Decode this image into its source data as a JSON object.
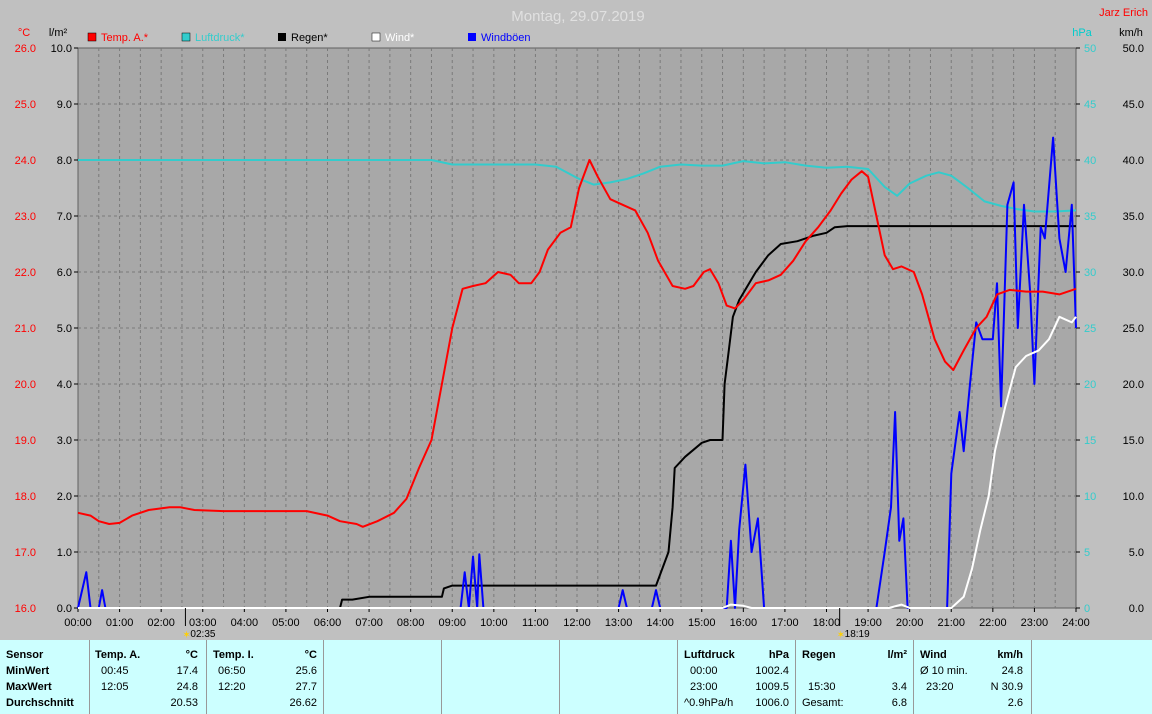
{
  "header": {
    "title": "Montag, 29.07.2019",
    "author": "Jarz Erich"
  },
  "colors": {
    "temp": "#ff0000",
    "pressure": "#33cccc",
    "rain": "#000000",
    "wind": "#ffffff",
    "gust": "#0000ff",
    "plot_bg": "#a8a8a8",
    "grid": "#808080"
  },
  "chart_data": {
    "type": "line",
    "title": "Montag, 29.07.2019",
    "legend": [
      "Temp. A.*",
      "Luftdruck*",
      "Regen*",
      "Wind*",
      "Windböen"
    ],
    "x_ticks": [
      "00:00",
      "01:00",
      "02:00",
      "03:00",
      "04:00",
      "05:00",
      "06:00",
      "07:00",
      "08:00",
      "09:00",
      "10:00",
      "11:00",
      "12:00",
      "13:00",
      "14:00",
      "15:00",
      "16:00",
      "17:00",
      "18:00",
      "19:00",
      "20:00",
      "21:00",
      "22:00",
      "23:00",
      "24:00"
    ],
    "axes": {
      "temp": {
        "unit": "°C",
        "range": [
          16,
          26
        ],
        "ticks": [
          "16.0",
          "17.0",
          "18.0",
          "19.0",
          "20.0",
          "21.0",
          "22.0",
          "23.0",
          "24.0",
          "25.0",
          "26.0"
        ]
      },
      "rain": {
        "unit": "l/m²",
        "range": [
          0,
          10
        ],
        "ticks": [
          "0.0",
          "1.0",
          "2.0",
          "3.0",
          "4.0",
          "5.0",
          "6.0",
          "7.0",
          "8.0",
          "9.0",
          "10.0"
        ]
      },
      "pressure": {
        "unit": "hPa",
        "ticks": [
          "0",
          "5",
          "10",
          "15",
          "20",
          "25",
          "30",
          "35",
          "40",
          "45",
          "50"
        ]
      },
      "wind": {
        "unit": "km/h",
        "range": [
          0,
          50
        ],
        "ticks": [
          "0.0",
          "5.0",
          "10.0",
          "15.0",
          "20.0",
          "25.0",
          "30.0",
          "35.0",
          "40.0",
          "45.0",
          "50.0"
        ]
      }
    },
    "markers": [
      {
        "time": "02:35"
      },
      {
        "time": "18:19"
      }
    ],
    "series": [
      {
        "name": "Temp. A.*",
        "axis": "temp",
        "points": [
          [
            0,
            17.7
          ],
          [
            0.3,
            17.65
          ],
          [
            0.5,
            17.55
          ],
          [
            0.75,
            17.5
          ],
          [
            1.0,
            17.52
          ],
          [
            1.3,
            17.65
          ],
          [
            1.7,
            17.75
          ],
          [
            2.2,
            17.8
          ],
          [
            2.45,
            17.8
          ],
          [
            2.8,
            17.75
          ],
          [
            3.5,
            17.73
          ],
          [
            4.5,
            17.73
          ],
          [
            5.5,
            17.73
          ],
          [
            6.0,
            17.65
          ],
          [
            6.3,
            17.55
          ],
          [
            6.7,
            17.5
          ],
          [
            6.85,
            17.45
          ],
          [
            7.2,
            17.55
          ],
          [
            7.6,
            17.7
          ],
          [
            7.9,
            17.95
          ],
          [
            8.2,
            18.5
          ],
          [
            8.5,
            19.0
          ],
          [
            8.75,
            20.0
          ],
          [
            9.0,
            21.0
          ],
          [
            9.25,
            21.7
          ],
          [
            9.5,
            21.75
          ],
          [
            9.8,
            21.8
          ],
          [
            10.1,
            22.0
          ],
          [
            10.4,
            21.95
          ],
          [
            10.6,
            21.8
          ],
          [
            10.9,
            21.8
          ],
          [
            11.1,
            22.0
          ],
          [
            11.3,
            22.4
          ],
          [
            11.6,
            22.7
          ],
          [
            11.85,
            22.8
          ],
          [
            12.05,
            23.5
          ],
          [
            12.3,
            24.0
          ],
          [
            12.5,
            23.7
          ],
          [
            12.8,
            23.3
          ],
          [
            13.1,
            23.2
          ],
          [
            13.4,
            23.1
          ],
          [
            13.7,
            22.7
          ],
          [
            13.95,
            22.2
          ],
          [
            14.3,
            21.75
          ],
          [
            14.6,
            21.7
          ],
          [
            14.8,
            21.75
          ],
          [
            15.05,
            22.0
          ],
          [
            15.2,
            22.05
          ],
          [
            15.4,
            21.8
          ],
          [
            15.6,
            21.4
          ],
          [
            15.8,
            21.35
          ],
          [
            16.0,
            21.5
          ],
          [
            16.3,
            21.8
          ],
          [
            16.6,
            21.85
          ],
          [
            16.9,
            21.95
          ],
          [
            17.2,
            22.2
          ],
          [
            17.5,
            22.55
          ],
          [
            17.8,
            22.8
          ],
          [
            18.1,
            23.1
          ],
          [
            18.35,
            23.4
          ],
          [
            18.6,
            23.65
          ],
          [
            18.85,
            23.8
          ],
          [
            19.0,
            23.7
          ],
          [
            19.2,
            23.0
          ],
          [
            19.4,
            22.3
          ],
          [
            19.6,
            22.05
          ],
          [
            19.8,
            22.1
          ],
          [
            20.1,
            22.0
          ],
          [
            20.3,
            21.6
          ],
          [
            20.6,
            20.8
          ],
          [
            20.85,
            20.4
          ],
          [
            21.05,
            20.25
          ],
          [
            21.3,
            20.6
          ],
          [
            21.6,
            21.0
          ],
          [
            21.85,
            21.2
          ],
          [
            22.1,
            21.6
          ],
          [
            22.4,
            21.68
          ],
          [
            22.8,
            21.65
          ],
          [
            23.2,
            21.65
          ],
          [
            23.6,
            21.6
          ],
          [
            24.0,
            21.7
          ]
        ]
      },
      {
        "name": "Luftdruck*",
        "axis": "pressure",
        "points": [
          [
            0,
            40
          ],
          [
            1,
            40
          ],
          [
            2,
            40
          ],
          [
            3,
            40
          ],
          [
            4,
            40
          ],
          [
            5,
            40
          ],
          [
            6,
            40
          ],
          [
            7,
            40
          ],
          [
            8,
            40
          ],
          [
            8.5,
            40
          ],
          [
            9,
            39.6
          ],
          [
            10,
            39.6
          ],
          [
            11,
            39.6
          ],
          [
            11.5,
            39.4
          ],
          [
            12,
            38.4
          ],
          [
            12.4,
            37.8
          ],
          [
            12.8,
            38.0
          ],
          [
            13.2,
            38.3
          ],
          [
            13.6,
            38.8
          ],
          [
            14,
            39.4
          ],
          [
            14.5,
            39.6
          ],
          [
            15,
            39.5
          ],
          [
            15.5,
            39.5
          ],
          [
            16,
            39.9
          ],
          [
            16.5,
            39.7
          ],
          [
            17,
            39.8
          ],
          [
            17.5,
            39.5
          ],
          [
            18,
            39.3
          ],
          [
            18.5,
            39.4
          ],
          [
            19,
            39.2
          ],
          [
            19.4,
            37.6
          ],
          [
            19.7,
            36.8
          ],
          [
            20,
            37.9
          ],
          [
            20.4,
            38.6
          ],
          [
            20.7,
            38.9
          ],
          [
            21,
            38.6
          ],
          [
            21.4,
            37.5
          ],
          [
            21.8,
            36.3
          ],
          [
            22.2,
            35.9
          ],
          [
            22.6,
            35.6
          ],
          [
            23,
            35.4
          ],
          [
            23.5,
            35.4
          ],
          [
            24,
            35.5
          ]
        ]
      },
      {
        "name": "Regen*",
        "axis": "rain",
        "points": [
          [
            0,
            0
          ],
          [
            6.3,
            0
          ],
          [
            6.35,
            0.15
          ],
          [
            6.6,
            0.15
          ],
          [
            7,
            0.2
          ],
          [
            8,
            0.2
          ],
          [
            8.75,
            0.2
          ],
          [
            8.8,
            0.35
          ],
          [
            9,
            0.4
          ],
          [
            9.5,
            0.4
          ],
          [
            10,
            0.4
          ],
          [
            13.9,
            0.4
          ],
          [
            14.2,
            1.0
          ],
          [
            14.3,
            1.8
          ],
          [
            14.35,
            2.5
          ],
          [
            14.6,
            2.7
          ],
          [
            15,
            2.95
          ],
          [
            15.2,
            3.0
          ],
          [
            15.5,
            3.0
          ],
          [
            15.55,
            4.0
          ],
          [
            15.65,
            4.6
          ],
          [
            15.75,
            5.2
          ],
          [
            15.9,
            5.5
          ],
          [
            16.1,
            5.75
          ],
          [
            16.3,
            6.0
          ],
          [
            16.6,
            6.3
          ],
          [
            16.9,
            6.5
          ],
          [
            17.3,
            6.55
          ],
          [
            17.7,
            6.65
          ],
          [
            18.0,
            6.7
          ],
          [
            18.2,
            6.8
          ],
          [
            18.5,
            6.82
          ],
          [
            19,
            6.82
          ],
          [
            20,
            6.82
          ],
          [
            22,
            6.82
          ],
          [
            24,
            6.82
          ]
        ]
      },
      {
        "name": "Wind*",
        "axis": "wind",
        "points": [
          [
            0,
            0
          ],
          [
            15.5,
            0
          ],
          [
            15.7,
            0.3
          ],
          [
            16.0,
            0.2
          ],
          [
            16.2,
            0
          ],
          [
            19.5,
            0
          ],
          [
            19.8,
            0.3
          ],
          [
            20.0,
            0
          ],
          [
            21.0,
            0
          ],
          [
            21.3,
            1.0
          ],
          [
            21.5,
            3.5
          ],
          [
            21.7,
            7.0
          ],
          [
            21.9,
            10.0
          ],
          [
            22.05,
            14.0
          ],
          [
            22.3,
            18.0
          ],
          [
            22.55,
            21.5
          ],
          [
            22.8,
            22.5
          ],
          [
            23.1,
            23.0
          ],
          [
            23.35,
            24.0
          ],
          [
            23.6,
            26.0
          ],
          [
            23.9,
            25.5
          ],
          [
            24.0,
            26.0
          ]
        ]
      },
      {
        "name": "Windböen",
        "axis": "wind",
        "points": [
          [
            0,
            0
          ],
          [
            0.2,
            3.2
          ],
          [
            0.3,
            0
          ],
          [
            0.5,
            0
          ],
          [
            0.58,
            1.6
          ],
          [
            0.66,
            0
          ],
          [
            9.2,
            0
          ],
          [
            9.3,
            3.2
          ],
          [
            9.4,
            0
          ],
          [
            9.5,
            4.6
          ],
          [
            9.6,
            0
          ],
          [
            9.65,
            4.8
          ],
          [
            9.75,
            0
          ],
          [
            13.0,
            0
          ],
          [
            13.1,
            1.6
          ],
          [
            13.2,
            0
          ],
          [
            13.8,
            0
          ],
          [
            13.9,
            1.6
          ],
          [
            14.0,
            0
          ],
          [
            15.6,
            0
          ],
          [
            15.7,
            6.0
          ],
          [
            15.8,
            0
          ],
          [
            15.9,
            7.0
          ],
          [
            16.05,
            12.8
          ],
          [
            16.2,
            5.0
          ],
          [
            16.35,
            8.0
          ],
          [
            16.5,
            0
          ],
          [
            19.2,
            0
          ],
          [
            19.4,
            5.0
          ],
          [
            19.55,
            9.0
          ],
          [
            19.65,
            17.5
          ],
          [
            19.75,
            6.0
          ],
          [
            19.85,
            8.0
          ],
          [
            19.95,
            0
          ],
          [
            20.9,
            0
          ],
          [
            21.0,
            12.0
          ],
          [
            21.2,
            17.5
          ],
          [
            21.3,
            14.0
          ],
          [
            21.45,
            20.0
          ],
          [
            21.6,
            25.5
          ],
          [
            21.75,
            24.0
          ],
          [
            22.0,
            24.0
          ],
          [
            22.1,
            29.0
          ],
          [
            22.2,
            18.0
          ],
          [
            22.35,
            36.0
          ],
          [
            22.5,
            38.0
          ],
          [
            22.6,
            25.0
          ],
          [
            22.75,
            36.0
          ],
          [
            22.9,
            28.0
          ],
          [
            23.0,
            20.0
          ],
          [
            23.15,
            34.0
          ],
          [
            23.25,
            33.0
          ],
          [
            23.45,
            42.0
          ],
          [
            23.6,
            33.0
          ],
          [
            23.75,
            30.0
          ],
          [
            23.9,
            36.0
          ],
          [
            24.0,
            25.0
          ]
        ]
      }
    ]
  },
  "panel": {
    "sensor": {
      "header": "Sensor",
      "rows": [
        "MinWert",
        "MaxWert",
        "Durchschnitt"
      ]
    },
    "temp_a": {
      "header": "Temp. A.",
      "unit": "°C",
      "min_time": "00:45",
      "min_val": "17.4",
      "max_time": "12:05",
      "max_val": "24.8",
      "avg": "20.53"
    },
    "temp_i": {
      "header": "Temp. I.",
      "unit": "°C",
      "min_time": "06:50",
      "min_val": "25.6",
      "max_time": "12:20",
      "max_val": "27.7",
      "avg": "26.62"
    },
    "pressure": {
      "header": "Luftdruck",
      "unit": "hPa",
      "min_time": "00:00",
      "min_val": "1002.4",
      "max_time": "23:00",
      "max_val": "1009.5",
      "trend_label": "^0.9hPa/h",
      "trend_val": "1006.0"
    },
    "rain": {
      "header": "Regen",
      "unit": "l/m²",
      "max_time": "15:30",
      "max_val": "3.4",
      "total_label": "Gesamt:",
      "total_val": "6.8"
    },
    "wind": {
      "header": "Wind",
      "unit": "km/h",
      "avg_label": "Ø 10 min.",
      "avg_val": "24.8",
      "max_time": "23:20",
      "max_val": "N 30.9",
      "day_avg": "2.6"
    }
  }
}
